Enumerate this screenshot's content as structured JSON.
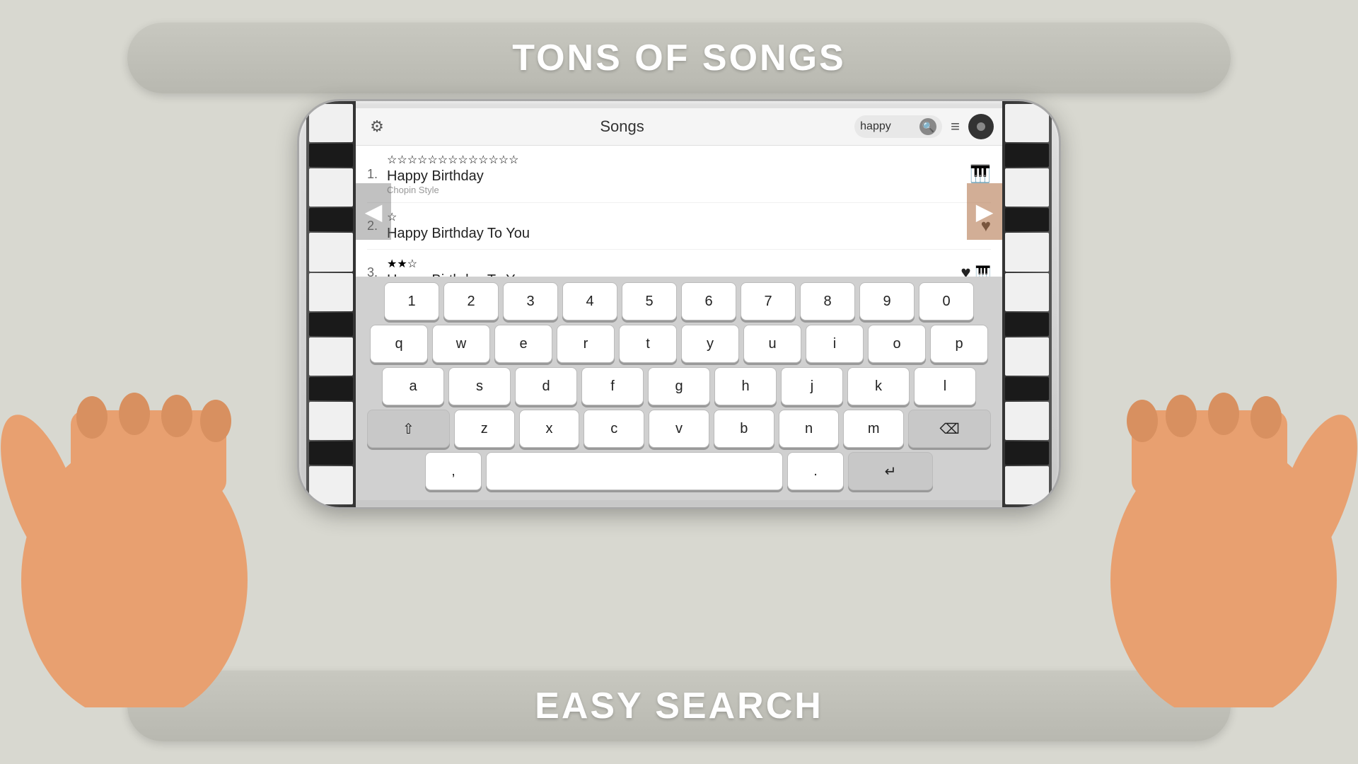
{
  "banners": {
    "top": "TONS OF SONGS",
    "bottom": "EASY SEARCH"
  },
  "app": {
    "title": "Songs",
    "search_value": "happy",
    "search_placeholder": "happy"
  },
  "songs": [
    {
      "number": "1.",
      "title": "Happy Birthday",
      "subtitle": "Chopin Style",
      "stars": [
        0,
        0,
        0,
        0,
        0,
        0,
        0,
        0,
        0,
        0,
        0,
        0,
        0
      ],
      "has_heart": true,
      "has_piano": true
    },
    {
      "number": "2.",
      "title": "Happy Birthday To You",
      "subtitle": "",
      "stars": [
        0
      ],
      "has_heart": true,
      "has_piano": false
    },
    {
      "number": "3.",
      "title": "Happy Birthday To You",
      "subtitle": "",
      "stars": [
        1,
        1,
        0
      ],
      "has_heart": true,
      "has_piano": true
    }
  ],
  "keyboard": {
    "row1": [
      "1",
      "2",
      "3",
      "4",
      "5",
      "6",
      "7",
      "8",
      "9",
      "0"
    ],
    "row2": [
      "q",
      "w",
      "e",
      "r",
      "t",
      "y",
      "u",
      "i",
      "o",
      "p"
    ],
    "row3": [
      "a",
      "s",
      "d",
      "f",
      "g",
      "h",
      "j",
      "k",
      "l"
    ],
    "row4": [
      "z",
      "x",
      "c",
      "v",
      "b",
      "n",
      "m"
    ],
    "shift_label": "⇧",
    "backspace_label": "⌫",
    "comma_label": ",",
    "space_label": "",
    "period_label": ".",
    "return_label": "↵"
  }
}
